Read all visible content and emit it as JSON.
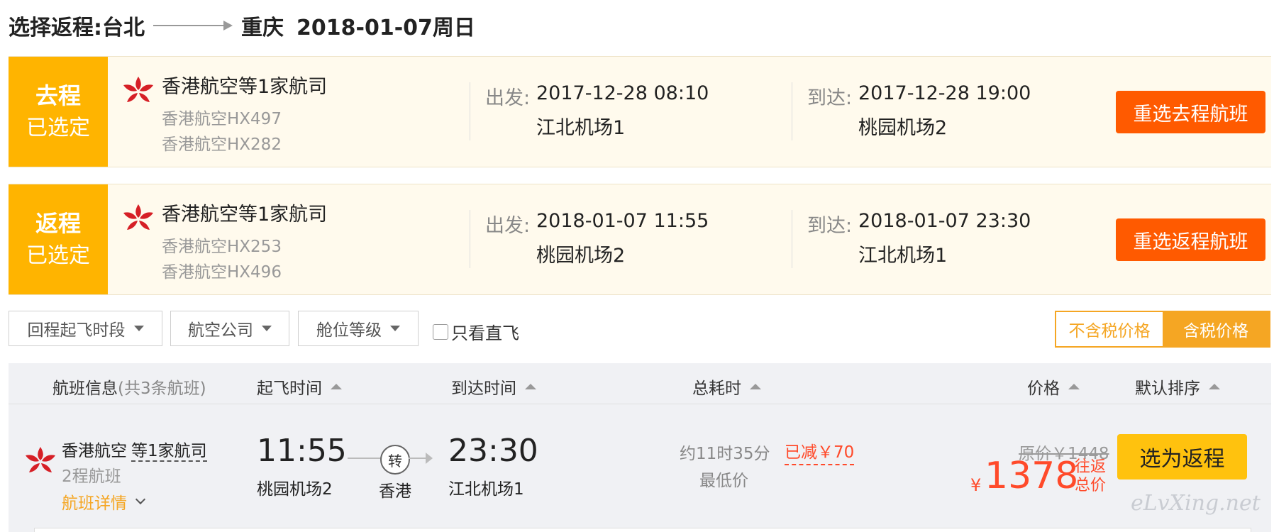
{
  "header": {
    "label": "选择返程:",
    "from": "台北",
    "to": "重庆",
    "date": "2018-01-07周日"
  },
  "segments": [
    {
      "tag1": "去程",
      "tag2": "已选定",
      "airline": "香港航空等1家航司",
      "flight1": "香港航空HX497",
      "flight2": "香港航空HX282",
      "depart_label": "出发:",
      "depart_time": "2017-12-28 08:10",
      "depart_airport": "江北机场1",
      "arrive_label": "到达:",
      "arrive_time": "2017-12-28 19:00",
      "arrive_airport": "桃园机场2",
      "button": "重选去程航班"
    },
    {
      "tag1": "返程",
      "tag2": "已选定",
      "airline": "香港航空等1家航司",
      "flight1": "香港航空HX253",
      "flight2": "香港航空HX496",
      "depart_label": "出发:",
      "depart_time": "2018-01-07 11:55",
      "depart_airport": "桃园机场2",
      "arrive_label": "到达:",
      "arrive_time": "2018-01-07 23:30",
      "arrive_airport": "江北机场1",
      "button": "重选返程航班"
    }
  ],
  "filters": {
    "time": "回程起飞时段",
    "airline": "航空公司",
    "cabin": "舱位等级",
    "direct": "只看直飞",
    "direct_checked": false
  },
  "price_toggle": {
    "excl_tax": "不含税价格",
    "incl_tax": "含税价格",
    "active": "incl_tax"
  },
  "table": {
    "headers": {
      "info": "航班信息",
      "count": "(共3条航班)",
      "depart": "起飞时间",
      "arrive": "到达时间",
      "duration": "总耗时",
      "price": "价格",
      "sort": "默认排序"
    },
    "rows": [
      {
        "airline": "香港航空",
        "more": "等1家航司",
        "legs": "2程航班",
        "detail": "航班详情",
        "depart_time": "11:55",
        "depart_airport": "桃园机场2",
        "transfer": "转",
        "via": "香港",
        "arrive_time": "23:30",
        "arrive_airport": "江北机场1",
        "duration": "约11时35分",
        "lowest": "最低价",
        "reduced": "已减￥70",
        "original": "原价￥1448",
        "currency": "¥",
        "price": "1378",
        "price_tag_1": "往返",
        "price_tag_2": "总价",
        "select": "选为返程"
      }
    ]
  },
  "watermark": "eLvXing.net",
  "colors": {
    "accent_yellow": "#ffb400",
    "rebook_orange": "#ff5a00",
    "price_red": "#ff4a2a",
    "select_yellow": "#ffc20e",
    "airline_logo_red": "#d61f26"
  },
  "icons": {
    "airline_logo": "hong-kong-airlines-logo",
    "dropdown": "caret-down-icon",
    "sort": "caret-up-icon",
    "expand": "chevron-down-icon"
  }
}
